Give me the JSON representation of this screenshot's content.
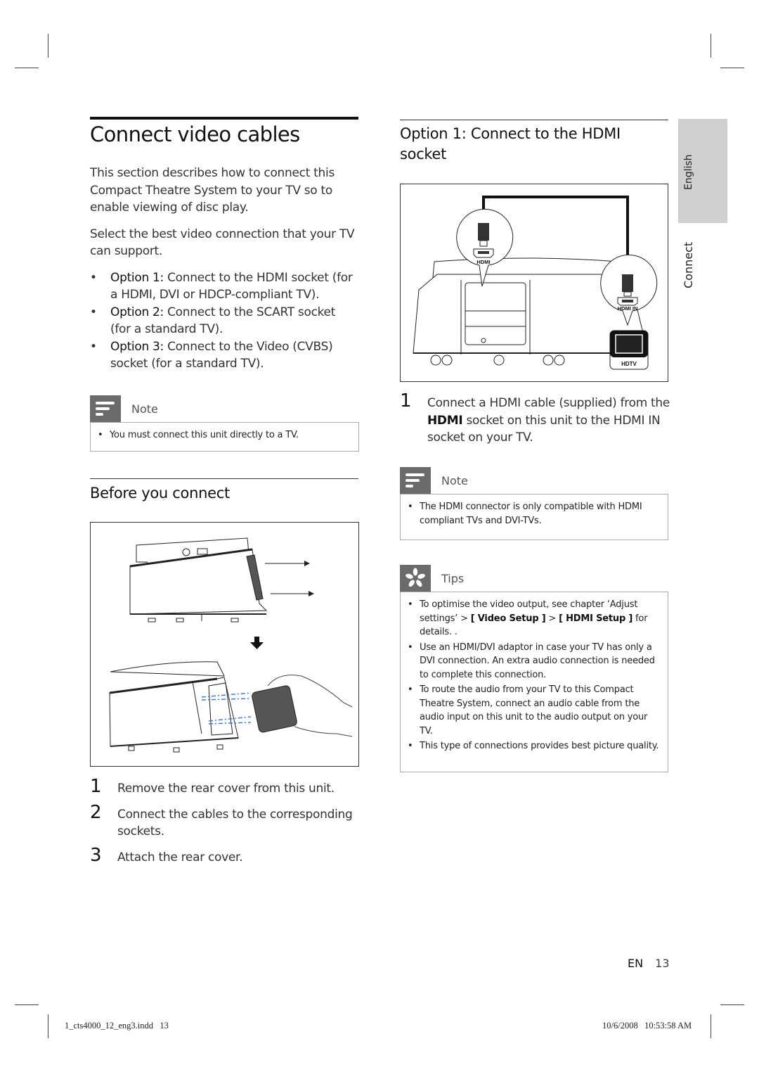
{
  "left": {
    "title": "Connect video cables",
    "intro": [
      "This section describes how to connect this Compact Theatre System to your TV so to enable viewing of disc play.",
      "Select the best video connection that your TV can support."
    ],
    "options": [
      {
        "label": "Option 1:",
        "text": " Connect to the HDMI socket (for a HDMI, DVI or HDCP-compliant TV)."
      },
      {
        "label": "Option 2:",
        "text": " Connect to the SCART socket (for a standard TV)."
      },
      {
        "label": "Option 3:",
        "text": " Connect to the Video (CVBS) socket (for a standard TV)."
      }
    ],
    "note": {
      "title": "Note",
      "items": [
        "You must connect this unit directly to a TV."
      ]
    },
    "section_title": "Before you connect",
    "figure_label": "Rear cover removal and cable connection illustration",
    "steps": [
      {
        "num": "1",
        "text": "Remove the rear cover from this unit."
      },
      {
        "num": "2",
        "text": "Connect the cables to the corresponding sockets."
      },
      {
        "num": "3",
        "text": "Attach the rear cover."
      }
    ]
  },
  "right": {
    "title": "Option 1: Connect to the HDMI socket",
    "figure": {
      "hdmi_label": "HDMI",
      "hdmi_in_label": "HDMI IN",
      "hdtv_label": "HDTV"
    },
    "step": {
      "num": "1",
      "text_a": "Connect a HDMI cable (supplied) from the ",
      "bold": "HDMI",
      "text_b": " socket on this unit to the HDMI IN socket on your TV."
    },
    "note": {
      "title": "Note",
      "items": [
        "The HDMI connector is only compatible with HDMI compliant TVs and DVI-TVs."
      ]
    },
    "tips": {
      "title": "Tips",
      "item1_a": "To optimise the video output, see chapter ‘Adjust settings’ > ",
      "item1_b1": "[ Video Setup ]",
      "item1_mid": " > ",
      "item1_b2": "[ HDMI Setup ]",
      "item1_c": " for details. .",
      "items": [
        "Use an HDMI/DVI adaptor in case your TV has only a DVI connection. An extra audio connection is needed to complete this connection.",
        "To route the audio from your TV to this Compact Theatre System, connect an audio cable from the audio input on this unit to the audio output on your TV.",
        "This type of connections provides best picture quality."
      ]
    }
  },
  "side_tabs": {
    "language": "English",
    "chapter": "Connect"
  },
  "footer": {
    "lang": "EN",
    "page": "13",
    "slug_file": "1_cts4000_12_eng3.indd   13",
    "slug_date": "10/6/2008   10:53:58 AM"
  },
  "bullet_char": "•"
}
